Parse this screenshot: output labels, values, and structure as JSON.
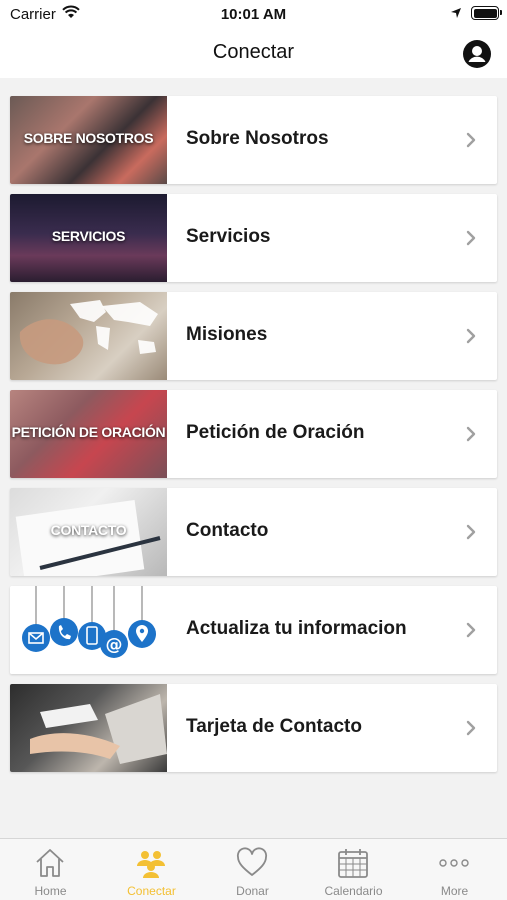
{
  "status_bar": {
    "carrier": "Carrier",
    "time": "10:01 AM"
  },
  "header": {
    "title": "Conectar"
  },
  "items": [
    {
      "label": "Sobre Nosotros",
      "thumb_caption": "SOBRE NOSOTROS"
    },
    {
      "label": "Servicios",
      "thumb_caption": "SERVICIOS"
    },
    {
      "label": "Misiones",
      "thumb_caption": ""
    },
    {
      "label": "Petición de Oración",
      "thumb_caption": "PETICIÓN DE ORACIÓN"
    },
    {
      "label": "Contacto",
      "thumb_caption": "CONTACTO"
    },
    {
      "label": "Actualiza tu informacion",
      "thumb_caption": ""
    },
    {
      "label": "Tarjeta de Contacto",
      "thumb_caption": ""
    }
  ],
  "tabs": [
    {
      "label": "Home",
      "icon": "home-icon"
    },
    {
      "label": "Conectar",
      "icon": "people-icon",
      "active": true
    },
    {
      "label": "Donar",
      "icon": "heart-icon"
    },
    {
      "label": "Calendario",
      "icon": "calendar-icon"
    },
    {
      "label": "More",
      "icon": "more-icon"
    }
  ],
  "colors": {
    "accent": "#f3c034",
    "tab_inactive": "#8a8a8a"
  }
}
